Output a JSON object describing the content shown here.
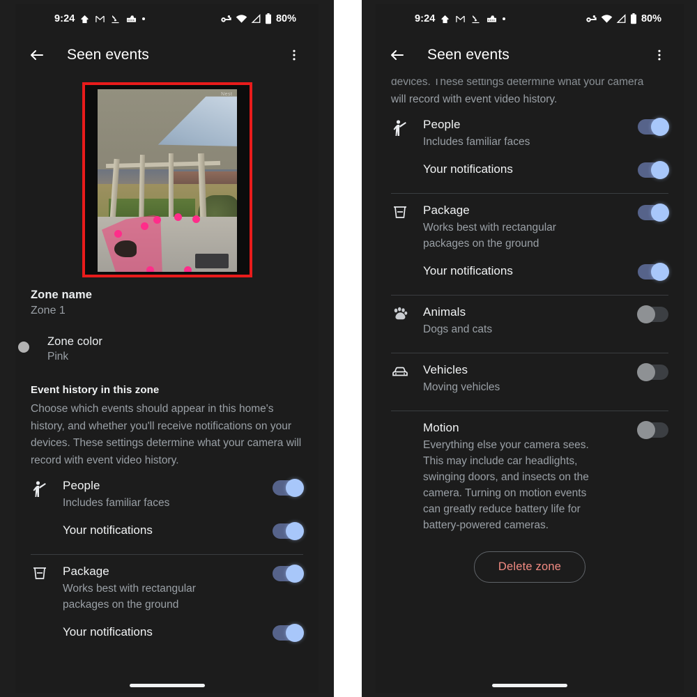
{
  "status_bar": {
    "time": "9:24",
    "icons_left": [
      "home-icon",
      "gmail-icon",
      "download-icon",
      "keyboard-icon",
      "dot-icon"
    ],
    "icons_right": [
      "vpn-key-icon",
      "wifi-icon",
      "signal-icon",
      "battery-icon"
    ],
    "battery_label": "80%"
  },
  "app_bar": {
    "back_icon": "back-arrow-icon",
    "title": "Seen events",
    "overflow_icon": "more-vert-icon"
  },
  "left_panel": {
    "thumbnail": {
      "watermark": "Nest",
      "highlight_color": "#e81b1b",
      "zone_overlay_color": "#ec407a"
    },
    "zone_name_label": "Zone name",
    "zone_name_value": "Zone 1",
    "zone_color_label": "Zone color",
    "zone_color_value": "Pink",
    "history_title": "Event history in this zone",
    "history_desc": "Choose which events should appear in this home's history, and whether you'll receive notifications on your devices. These settings determine what your camera will record with event video history.",
    "options": [
      {
        "icon": "person-icon",
        "title": "People",
        "subtitle": "Includes familiar faces",
        "toggle": "on",
        "notifications_label": "Your notifications",
        "notifications_toggle": "on"
      },
      {
        "icon": "package-icon",
        "title": "Package",
        "subtitle": "Works best with rectangular packages on the ground",
        "toggle": "on",
        "notifications_label": "Your notifications",
        "notifications_toggle": "on"
      }
    ]
  },
  "right_panel": {
    "scrolled_text_line1": "devices. These settings determine what your camera",
    "scrolled_text_line2": "will record with event video history.",
    "options": [
      {
        "icon": "person-icon",
        "title": "People",
        "subtitle": "Includes familiar faces",
        "toggle": "on",
        "notifications_label": "Your notifications",
        "notifications_toggle": "on"
      },
      {
        "icon": "package-icon",
        "title": "Package",
        "subtitle": "Works best with rectangular packages on the ground",
        "toggle": "on",
        "notifications_label": "Your notifications",
        "notifications_toggle": "on"
      },
      {
        "icon": "paw-icon",
        "title": "Animals",
        "subtitle": "Dogs and cats",
        "toggle": "off"
      },
      {
        "icon": "car-icon",
        "title": "Vehicles",
        "subtitle": "Moving vehicles",
        "toggle": "off"
      },
      {
        "icon": "none",
        "title": "Motion",
        "subtitle": "Everything else your camera sees. This may include car headlights, swinging doors, and insects on the camera. Turning on motion events can greatly reduce battery life for battery-powered cameras.",
        "toggle": "off"
      }
    ],
    "delete_button": "Delete zone",
    "delete_color": "#f28b82"
  },
  "nav": {
    "handle": "home-gesture-handle"
  }
}
